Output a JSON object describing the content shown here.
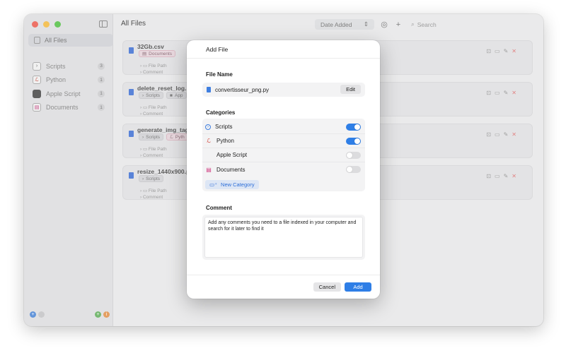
{
  "sidebar": {
    "all_files": "All Files",
    "items": [
      {
        "label": "Scripts",
        "count": "3",
        "icon": "terminal-icon"
      },
      {
        "label": "Python",
        "count": "1",
        "icon": "python-icon"
      },
      {
        "label": "Apple Script",
        "count": "1",
        "icon": "applescript-icon"
      },
      {
        "label": "Documents",
        "count": "1",
        "icon": "document-icon"
      }
    ]
  },
  "main": {
    "title": "All Files",
    "sort": "Date Added",
    "search_placeholder": "Search",
    "files": [
      {
        "name": "32Gb.csv",
        "chips": [
          "Documents"
        ],
        "path": "File Path",
        "comment": "Comment"
      },
      {
        "name": "delete_reset_log.s",
        "chips": [
          "Scripts",
          "App"
        ],
        "path": "File Path",
        "comment": "Comment"
      },
      {
        "name": "generate_img_tags",
        "chips": [
          "Scripts",
          "Pyth"
        ],
        "path": "File Path",
        "comment": "Comment"
      },
      {
        "name": "resize_1440x900.p",
        "chips": [
          "Scripts"
        ],
        "path": "File Path",
        "comment": "Comment"
      }
    ]
  },
  "modal": {
    "title": "Add File",
    "file_name_label": "File Name",
    "file_name": "convertisseur_png.py",
    "edit_label": "Edit",
    "categories_label": "Categories",
    "categories": [
      {
        "label": "Scripts",
        "enabled": true
      },
      {
        "label": "Python",
        "enabled": true
      },
      {
        "label": "Apple Script",
        "enabled": false
      },
      {
        "label": "Documents",
        "enabled": false
      }
    ],
    "new_category_label": "New Category",
    "comment_label": "Comment",
    "comment_text": "Add any comments you need to a file indexed in your computer and search for it later to find it",
    "cancel_label": "Cancel",
    "add_label": "Add"
  },
  "colors": {
    "accent": "#2e7ee6",
    "danger": "#e07c7c"
  }
}
